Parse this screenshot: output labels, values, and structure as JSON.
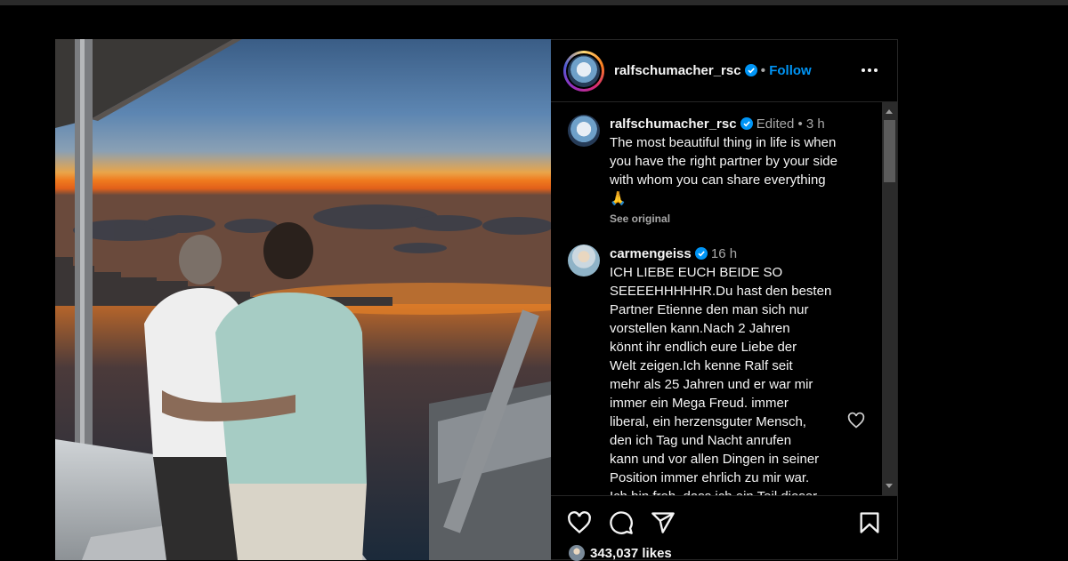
{
  "window": {
    "topbar_color": "#2a2a2a"
  },
  "post": {
    "image_alt": "Two men on a boat watching the sunset",
    "author": {
      "username": "ralfschumacher_rsc",
      "verified": true,
      "separator": "•",
      "follow_label": "Follow"
    },
    "more_icon": "more-horizontal-icon"
  },
  "comments": [
    {
      "username": "ralfschumacher_rsc",
      "verified": true,
      "edited_label": "Edited",
      "dot": "•",
      "time": "3 h",
      "lines": [
        "The most beautiful thing in life is when",
        "you have the right partner by your side",
        "with whom you can share everything",
        "🙏"
      ],
      "see_original": "See original"
    },
    {
      "username": "carmengeiss",
      "verified": true,
      "time": "16 h",
      "lines": [
        "ICH LIEBE EUCH BEIDE SO",
        "SEEEEHHHHHR.Du hast den besten",
        "Partner Etienne den man sich nur",
        "vorstellen kann.Nach 2 Jahren",
        "könnt ihr endlich eure Liebe der",
        "Welt zeigen.Ich kenne Ralf seit",
        "mehr als 25 Jahren und er war mir",
        "immer ein Mega Freud. immer",
        "liberal, ein herzensguter Mensch,",
        "den ich Tag und Nacht anrufen",
        "kann und vor allen Dingen in seiner",
        "Position immer ehrlich zu mir war.",
        "Ich bin froh, dass ich ein Teil dieser"
      ]
    }
  ],
  "actions": {
    "icons": [
      "heart-icon",
      "comment-icon",
      "share-icon",
      "bookmark-icon"
    ],
    "likes_label": "343,037 likes"
  },
  "colors": {
    "accent": "#0095f6",
    "verified": "#0095f6",
    "muted": "#a8a8a8",
    "background": "#000000"
  }
}
